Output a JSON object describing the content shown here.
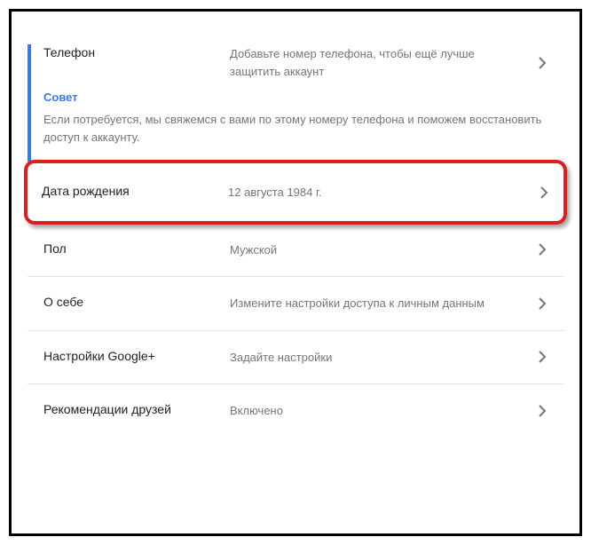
{
  "rows": {
    "phone": {
      "label": "Телефон",
      "value": "Добавьте номер телефона, чтобы ещё лучше защитить аккаунт"
    },
    "tip": {
      "title": "Совет",
      "text": "Если потребуется, мы свяжемся с вами по этому номеру телефона и поможем восстановить доступ к аккаунту."
    },
    "birthday": {
      "label": "Дата рождения",
      "value": "12 августа 1984 г."
    },
    "gender": {
      "label": "Пол",
      "value": "Мужской"
    },
    "about": {
      "label": "О себе",
      "value": "Измените настройки доступа к личным данным"
    },
    "gplus": {
      "label": "Настройки Google+",
      "value": "Задайте настройки"
    },
    "friends": {
      "label": "Рекомендации друзей",
      "value": "Включено"
    }
  }
}
